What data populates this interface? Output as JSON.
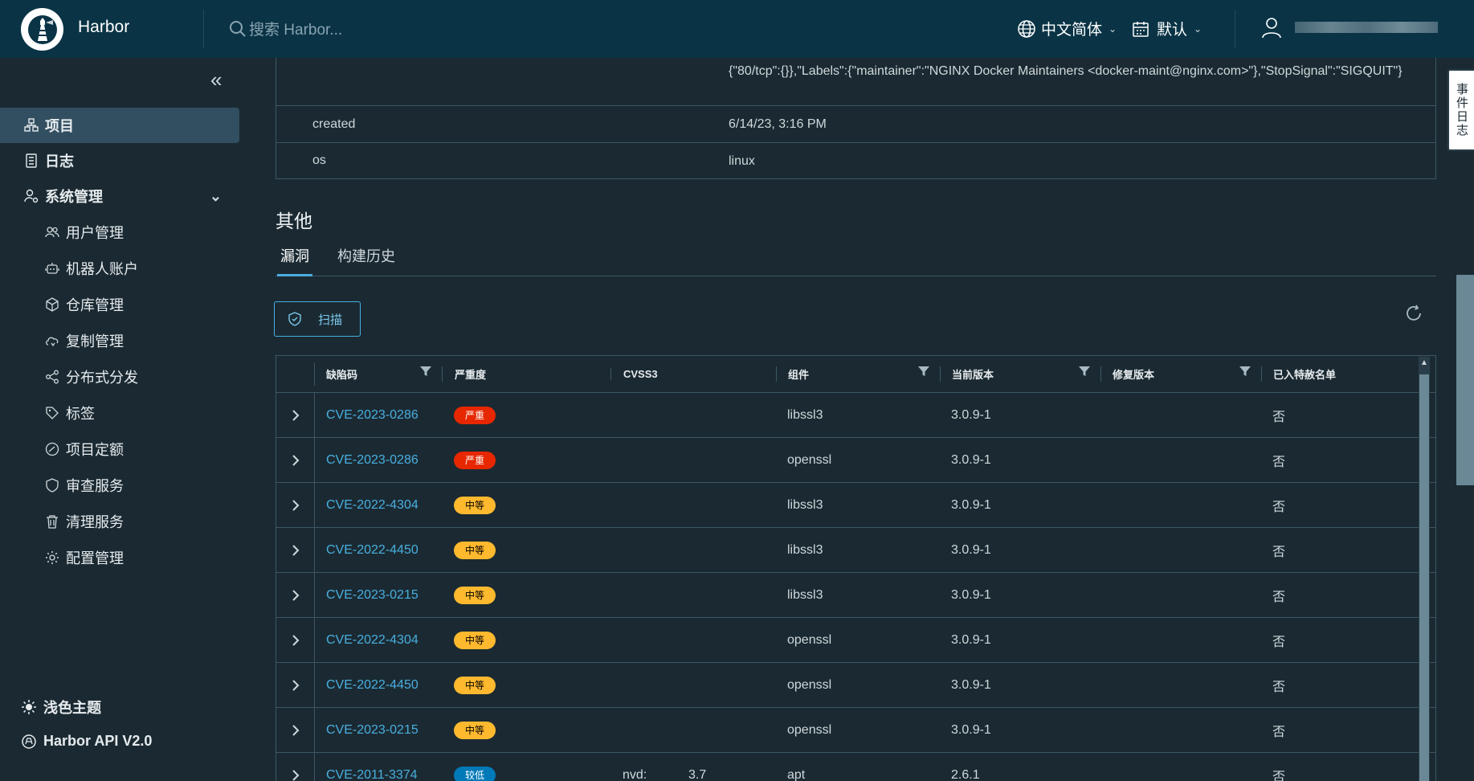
{
  "header": {
    "app_title": "Harbor",
    "search_placeholder": "搜索 Harbor...",
    "language": "中文简体",
    "date_format": "默认"
  },
  "sidebar": {
    "items": [
      {
        "label": "项目",
        "icon": "projects-icon",
        "active": true
      },
      {
        "label": "日志",
        "icon": "logs-icon"
      },
      {
        "label": "系统管理",
        "icon": "admin-icon",
        "expanded": true
      }
    ],
    "sub_items": [
      {
        "label": "用户管理",
        "icon": "users-icon"
      },
      {
        "label": "机器人账户",
        "icon": "robot-icon"
      },
      {
        "label": "仓库管理",
        "icon": "registry-icon"
      },
      {
        "label": "复制管理",
        "icon": "replication-icon"
      },
      {
        "label": "分布式分发",
        "icon": "distribution-icon"
      },
      {
        "label": "标签",
        "icon": "tag-icon"
      },
      {
        "label": "项目定额",
        "icon": "quota-icon"
      },
      {
        "label": "审查服务",
        "icon": "shield-icon"
      },
      {
        "label": "清理服务",
        "icon": "trash-icon"
      },
      {
        "label": "配置管理",
        "icon": "gear-icon"
      }
    ],
    "footer": {
      "theme": "浅色主题",
      "api": "Harbor API V2.0"
    }
  },
  "side_panel": {
    "label": "事件日志"
  },
  "properties": {
    "config_value": "{\"80/tcp\":{}},\"Labels\":{\"maintainer\":\"NGINX Docker Maintainers <docker-maint@nginx.com>\"},\"StopSignal\":\"SIGQUIT\"}",
    "rows": [
      {
        "key": "created",
        "value": "6/14/23, 3:16 PM"
      },
      {
        "key": "os",
        "value": "linux"
      }
    ]
  },
  "section": {
    "title": "其他"
  },
  "tabs": [
    {
      "label": "漏洞",
      "active": true
    },
    {
      "label": "构建历史"
    }
  ],
  "toolbar": {
    "scan_label": "扫描"
  },
  "table": {
    "headers": [
      "缺陷码",
      "严重度",
      "CVSS3",
      "组件",
      "当前版本",
      "修复版本",
      "已入特赦名单"
    ],
    "rows": [
      {
        "cve": "CVE-2023-0286",
        "severity": "严重",
        "level": "crit",
        "cvss_src": "",
        "cvss": "",
        "component": "libssl3",
        "version": "3.0.9-1",
        "fix": "",
        "allowlisted": "否"
      },
      {
        "cve": "CVE-2023-0286",
        "severity": "严重",
        "level": "crit",
        "cvss_src": "",
        "cvss": "",
        "component": "openssl",
        "version": "3.0.9-1",
        "fix": "",
        "allowlisted": "否"
      },
      {
        "cve": "CVE-2022-4304",
        "severity": "中等",
        "level": "med",
        "cvss_src": "",
        "cvss": "",
        "component": "libssl3",
        "version": "3.0.9-1",
        "fix": "",
        "allowlisted": "否"
      },
      {
        "cve": "CVE-2022-4450",
        "severity": "中等",
        "level": "med",
        "cvss_src": "",
        "cvss": "",
        "component": "libssl3",
        "version": "3.0.9-1",
        "fix": "",
        "allowlisted": "否"
      },
      {
        "cve": "CVE-2023-0215",
        "severity": "中等",
        "level": "med",
        "cvss_src": "",
        "cvss": "",
        "component": "libssl3",
        "version": "3.0.9-1",
        "fix": "",
        "allowlisted": "否"
      },
      {
        "cve": "CVE-2022-4304",
        "severity": "中等",
        "level": "med",
        "cvss_src": "",
        "cvss": "",
        "component": "openssl",
        "version": "3.0.9-1",
        "fix": "",
        "allowlisted": "否"
      },
      {
        "cve": "CVE-2022-4450",
        "severity": "中等",
        "level": "med",
        "cvss_src": "",
        "cvss": "",
        "component": "openssl",
        "version": "3.0.9-1",
        "fix": "",
        "allowlisted": "否"
      },
      {
        "cve": "CVE-2023-0215",
        "severity": "中等",
        "level": "med",
        "cvss_src": "",
        "cvss": "",
        "component": "openssl",
        "version": "3.0.9-1",
        "fix": "",
        "allowlisted": "否"
      },
      {
        "cve": "CVE-2011-3374",
        "severity": "较低",
        "level": "low",
        "cvss_src": "nvd:",
        "cvss": "3.7",
        "component": "apt",
        "version": "2.6.1",
        "fix": "",
        "allowlisted": "否"
      }
    ]
  },
  "colors": {
    "header_bg": "#0a3446",
    "body_bg": "#1b2a32",
    "accent": "#49aee0",
    "critical": "#e62700",
    "medium": "#ffb92e",
    "low": "#0079b8"
  }
}
